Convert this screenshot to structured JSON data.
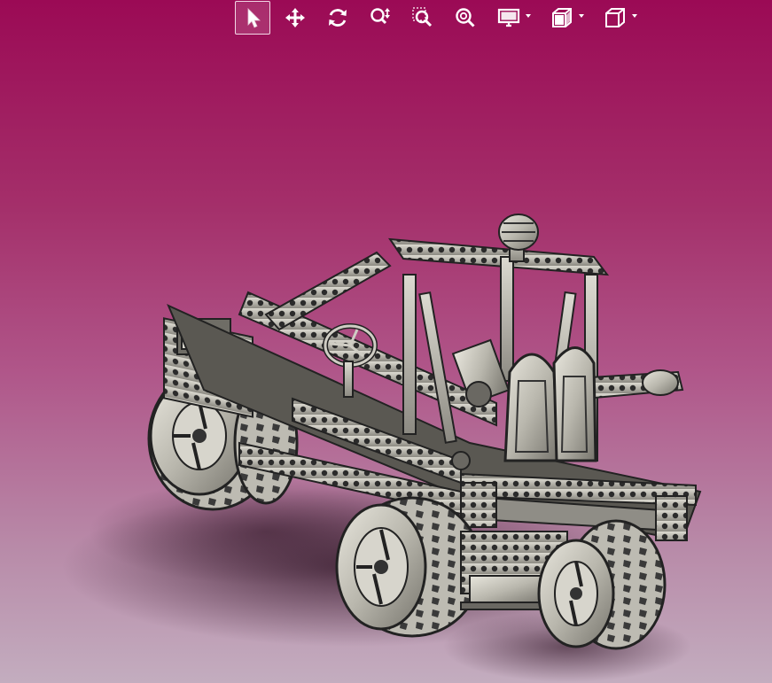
{
  "app": {
    "viewport": "3d-model-viewport"
  },
  "toolbar": {
    "buttons": [
      {
        "id": "select",
        "icon": "pointer-arrow-icon",
        "active": true
      },
      {
        "id": "pan",
        "icon": "move-arrows-icon",
        "active": false
      },
      {
        "id": "rotate",
        "icon": "rotate-icon",
        "active": false
      },
      {
        "id": "zoom-in-out",
        "icon": "zoom-updown-icon",
        "active": false
      },
      {
        "id": "zoom-area",
        "icon": "zoom-area-icon",
        "active": false
      },
      {
        "id": "zoom-fit",
        "icon": "zoom-fit-icon",
        "active": false
      },
      {
        "id": "display-style",
        "icon": "monitor-icon",
        "has_menu": true
      },
      {
        "id": "section-view",
        "icon": "section-view-icon",
        "has_menu": true
      },
      {
        "id": "view-orientation",
        "icon": "cube-view-icon",
        "has_menu": true
      }
    ]
  },
  "colors": {
    "bg_top": "#9b0a55",
    "bg_bottom": "#c3adbf",
    "toolbar_icon": "#ffffff",
    "model_metal": "#c8c6bd",
    "model_dark": "#2b2b2b"
  },
  "model": {
    "name": "technic-buggy-model",
    "parts": [
      "front-left-wheel",
      "front-right-wheel",
      "rear-left-wheel",
      "rear-right-wheel",
      "chassis-frame",
      "roll-cage",
      "steering-wheel",
      "seat"
    ]
  }
}
